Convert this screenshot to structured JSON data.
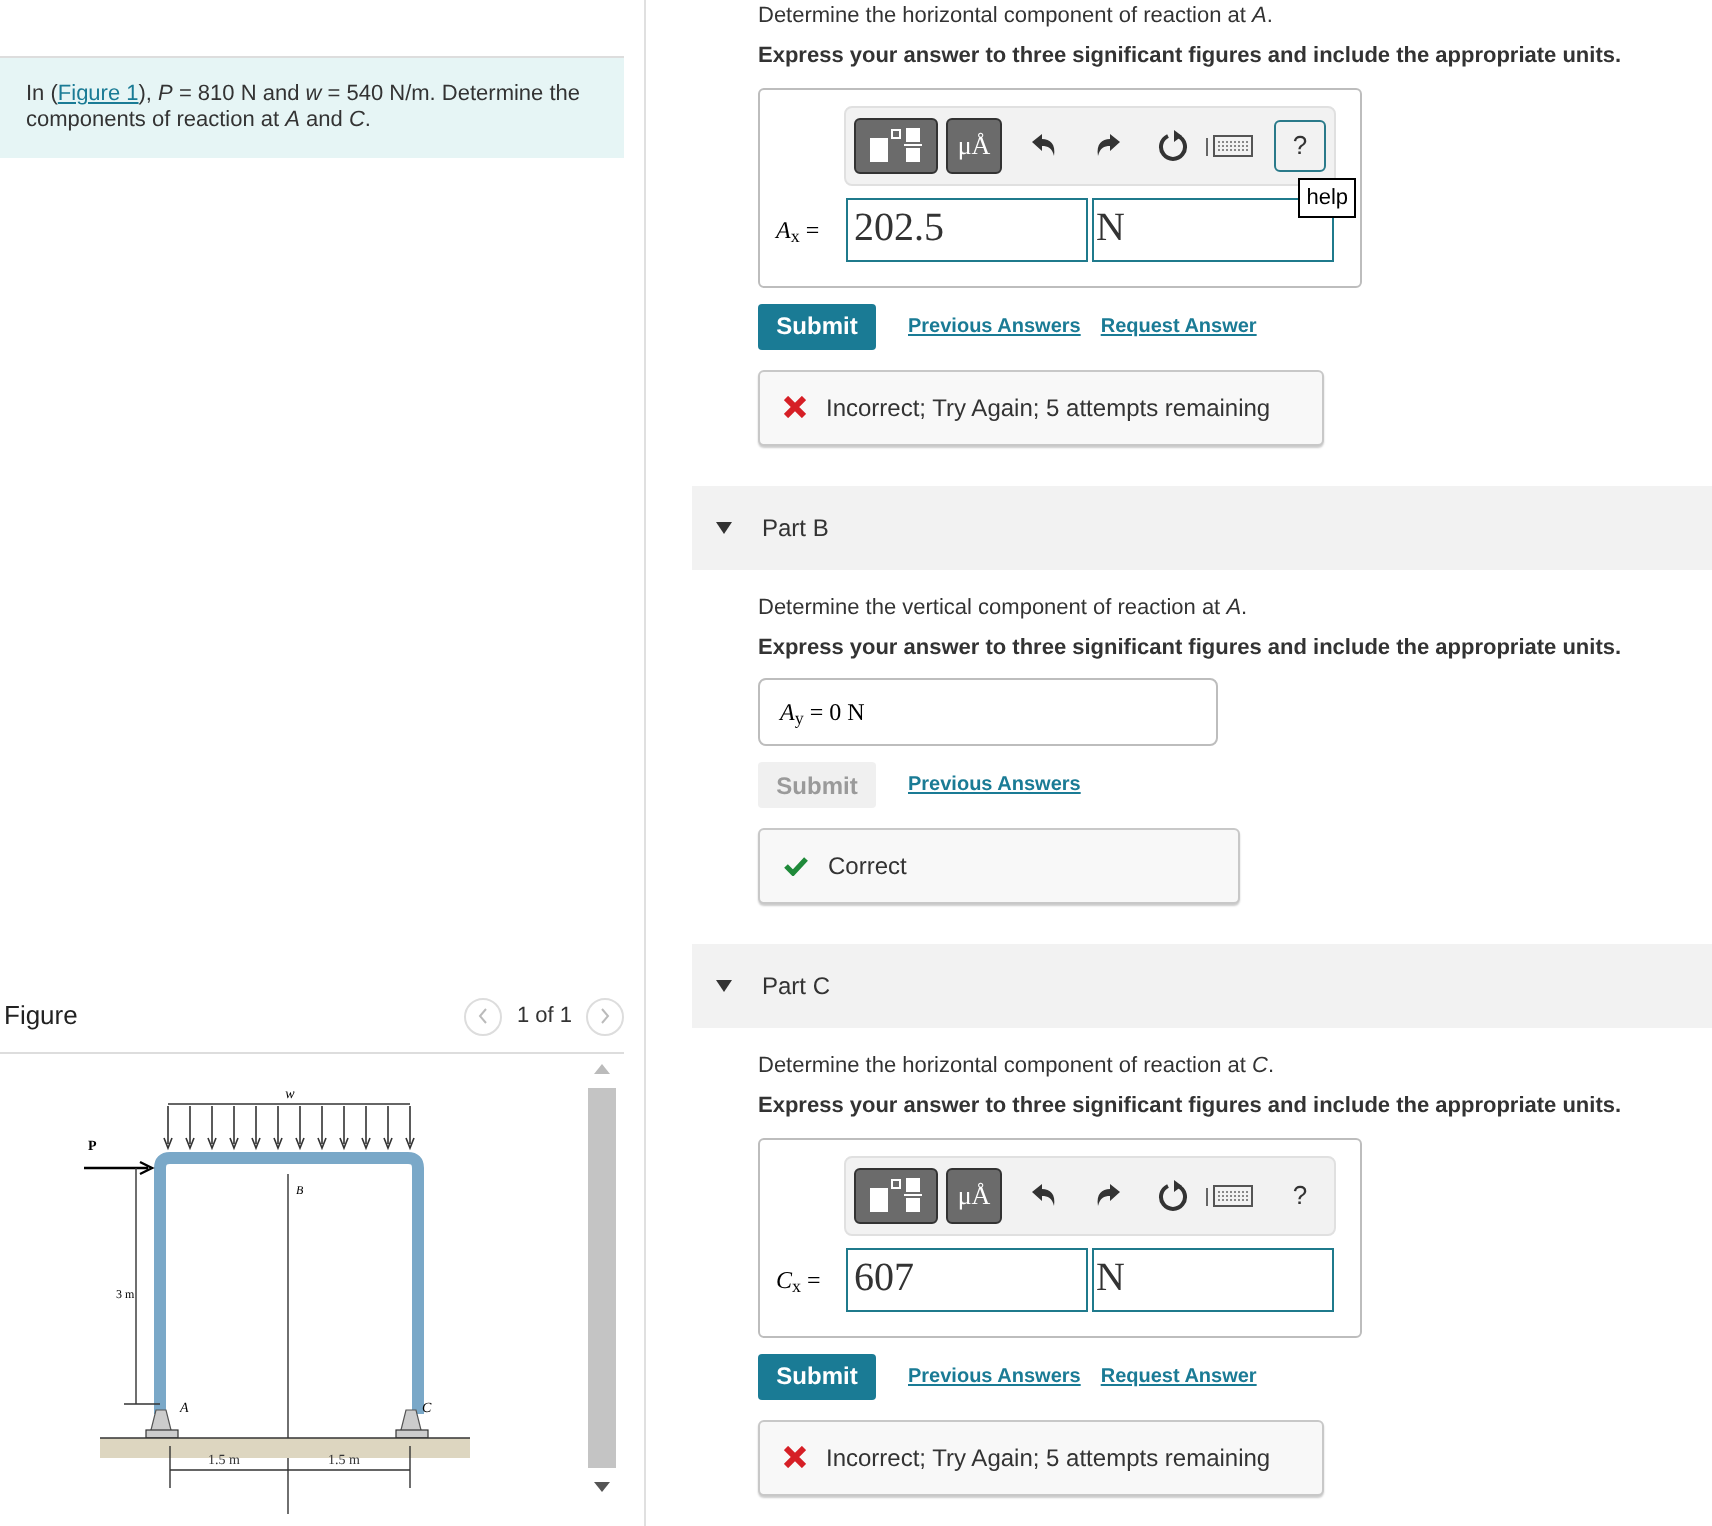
{
  "problem": {
    "prefix": "In (",
    "link": "Figure 1",
    "suffix": "), *P* = 810 N and *w* = 540 N/m. Determine the components of reaction at *A* and *C*."
  },
  "figure": {
    "title": "Figure",
    "pager": "1 of 1",
    "labels": {
      "w": "w",
      "p": "P",
      "b": "B",
      "height": "3 m",
      "a": "A",
      "c": "C",
      "span_left": "1.5 m",
      "span_right": "1.5 m"
    }
  },
  "parts": [
    {
      "prompt": "Determine the horizontal component of reaction at *A*.",
      "instruction": "Express your answer to three significant figures and include the appropriate units.",
      "answer": {
        "kind": "editor",
        "units_button": "μÅ",
        "help_button": "?",
        "tooltip": "help",
        "symbol": "*A*$_{x}$ =",
        "value": "202.5",
        "unit": "N"
      },
      "submit": {
        "label": "Submit",
        "disabled": false
      },
      "links": [
        "Previous Answers",
        "Request Answer"
      ],
      "feedback": {
        "kind": "incorrect",
        "text": "Incorrect; Try Again; 5 attempts remaining"
      }
    },
    {
      "title": "Part B",
      "expanded": true,
      "prompt": "Determine the vertical component of reaction at *A*.",
      "instruction": "Express your answer to three significant figures and include the appropriate units.",
      "answer": {
        "kind": "answered",
        "symbol": "*A*$_{y}$ =",
        "value": "0 N"
      },
      "submit": {
        "label": "Submit",
        "disabled": true
      },
      "links": [
        "Previous Answers"
      ],
      "feedback": {
        "kind": "correct",
        "text": "Correct"
      }
    },
    {
      "title": "Part C",
      "expanded": true,
      "prompt": "Determine the horizontal component of reaction at *C*.",
      "instruction": "Express your answer to three significant figures and include the appropriate units.",
      "answer": {
        "kind": "editor",
        "units_button": "μÅ",
        "help_button": "?",
        "symbol": "*C*$_{x}$ =",
        "value": "607",
        "unit": "N"
      },
      "submit": {
        "label": "Submit",
        "disabled": false
      },
      "links": [
        "Previous Answers",
        "Request Answer"
      ],
      "feedback": {
        "kind": "incorrect",
        "text": "Incorrect; Try Again; 5 attempts remaining"
      }
    }
  ]
}
